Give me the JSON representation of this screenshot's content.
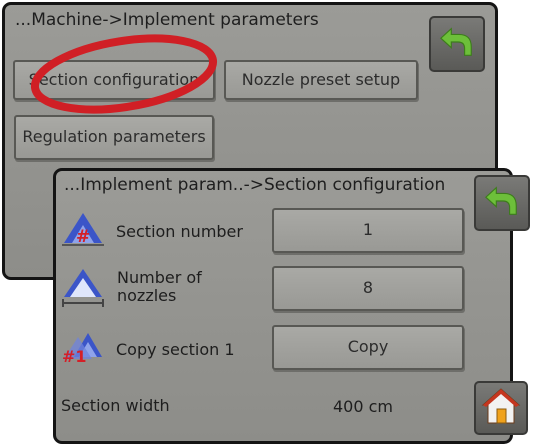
{
  "back_panel": {
    "title": "...Machine->Implement parameters",
    "buttons": {
      "section_configuration": "Section configuration",
      "nozzle_preset_setup": "Nozzle preset setup",
      "regulation_parameters": "Regulation parameters"
    }
  },
  "front_panel": {
    "title": "...Implement param..->Section configuration",
    "rows": {
      "section_number": {
        "label": "Section number",
        "value": "1"
      },
      "number_of_nozzles": {
        "label": "Number of nozzles",
        "value": "8"
      },
      "copy_section": {
        "label": "Copy section 1",
        "button": "Copy"
      },
      "section_width": {
        "label": "Section width",
        "value": "400 cm"
      }
    }
  },
  "icons": {
    "back": "back-arrow-icon",
    "home": "home-icon",
    "section_number": "section-number-icon",
    "nozzles": "nozzles-icon",
    "copy_section": "copy-section-icon"
  },
  "colors": {
    "panel_bg": "#9b9b97",
    "back_arrow": "#6dbf3a",
    "highlight_ellipse": "#d01f25"
  }
}
